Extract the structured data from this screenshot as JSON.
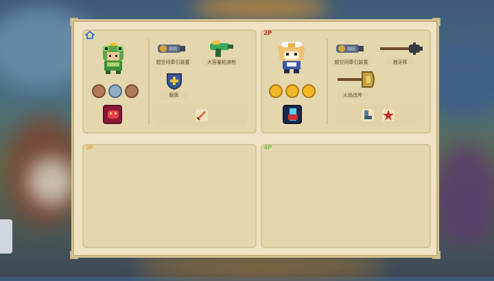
{
  "players": [
    {
      "tag": "",
      "tag_icon": "home-icon",
      "character": "frog-knight",
      "weapons": [
        {
          "label": "超空间牵引装置",
          "icon": "gravity-cannon-icon"
        },
        {
          "label": "大容量粘液枪",
          "icon": "slime-gun-icon"
        },
        {
          "label": "盾牌",
          "icon": "shield-icon"
        }
      ],
      "buffs": [
        "sword-buff-icon",
        "shield-buff-icon",
        "fist-buff-icon"
      ],
      "skill": "red-beast-skill-icon",
      "extra": [
        "sword-icon"
      ]
    },
    {
      "tag": "2P",
      "character": "hamster-chef",
      "weapons": [
        {
          "label": "超空间牵引装置",
          "icon": "gravity-cannon-icon"
        },
        {
          "label": "狼牙棒",
          "icon": "mace-icon"
        },
        {
          "label": "火焰战斧",
          "icon": "fire-axe-icon"
        }
      ],
      "buffs": [
        "gold-buff-icon",
        "gold-fist-buff-icon",
        "gold-shield-buff-icon"
      ],
      "skill": "lightning-skill-icon",
      "extra": [
        "boots-icon",
        "star-shield-icon"
      ]
    },
    {
      "tag": "3P"
    },
    {
      "tag": "4P"
    }
  ],
  "colors": {
    "panel": "#efe3c4",
    "slot": "#e4d6ad",
    "tag_2p": "#c8302a",
    "tag_3p": "#e0b24a",
    "tag_4p": "#7dc75a",
    "home": "#3a7ad8"
  }
}
